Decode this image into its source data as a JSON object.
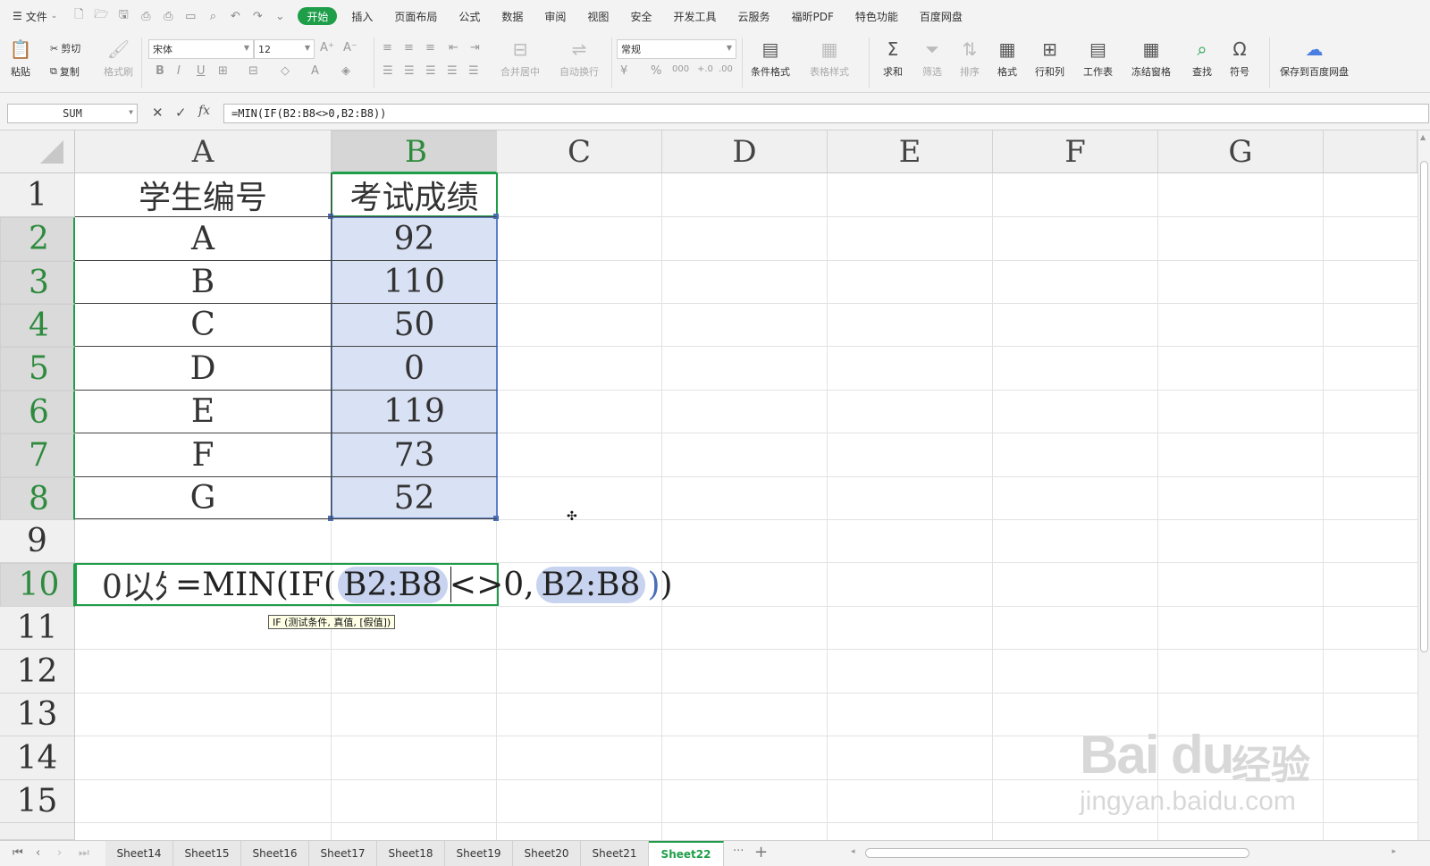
{
  "menubar": {
    "file_label": "文件",
    "tabs": [
      "开始",
      "插入",
      "页面布局",
      "公式",
      "数据",
      "审阅",
      "视图",
      "安全",
      "开发工具",
      "云服务",
      "福昕PDF",
      "特色功能",
      "百度网盘"
    ],
    "active_tab": "开始"
  },
  "ribbon": {
    "paste": "粘贴",
    "cut": "剪切",
    "copy": "复制",
    "format_painter": "格式刷",
    "font_name": "宋体",
    "font_size": "12",
    "merge_center": "合并居中",
    "wrap_text": "自动换行",
    "number_format": "常规",
    "conditional_format": "条件格式",
    "table_style": "表格样式",
    "sum": "求和",
    "filter": "筛选",
    "sort": "排序",
    "format": "格式",
    "row_col": "行和列",
    "worksheet": "工作表",
    "freeze": "冻结窗格",
    "find": "查找",
    "symbol": "符号",
    "save_baidu": "保存到百度网盘"
  },
  "formula_bar": {
    "name_box": "SUM",
    "formula": "=MIN(IF(B2:B8<>0,B2:B8))"
  },
  "grid": {
    "columns": [
      "A",
      "B",
      "C",
      "D",
      "E",
      "F",
      "G"
    ],
    "rows": [
      "1",
      "2",
      "3",
      "4",
      "5",
      "6",
      "7",
      "8",
      "9",
      "10",
      "11",
      "12",
      "13",
      "14",
      "15"
    ],
    "header_a": "学生编号",
    "header_b": "考试成绩",
    "students": [
      "A",
      "B",
      "C",
      "D",
      "E",
      "F",
      "G"
    ],
    "scores": [
      "92",
      "110",
      "50",
      "0",
      "119",
      "73",
      "52"
    ],
    "a10_text": "0以外",
    "edit": {
      "prefix": "=MIN(IF(",
      "ref1": "B2:B8",
      "op": "<>0,",
      "ref2": "B2:B8",
      "close_inner": ")",
      "close_outer": ")"
    },
    "tooltip": "IF (测试条件, 真值, [假值])"
  },
  "sheets": {
    "tabs": [
      "Sheet14",
      "Sheet15",
      "Sheet16",
      "Sheet17",
      "Sheet18",
      "Sheet19",
      "Sheet20",
      "Sheet21",
      "Sheet22"
    ],
    "active": "Sheet22",
    "more": "···",
    "add": "+"
  },
  "watermark": {
    "logo": "Bai du",
    "cn": "经验",
    "url": "jingyan.baidu.com"
  },
  "colors": {
    "accent": "#1f9e4a",
    "selection_fill": "#d9e1f4",
    "selection_border": "#5b7fc9"
  }
}
